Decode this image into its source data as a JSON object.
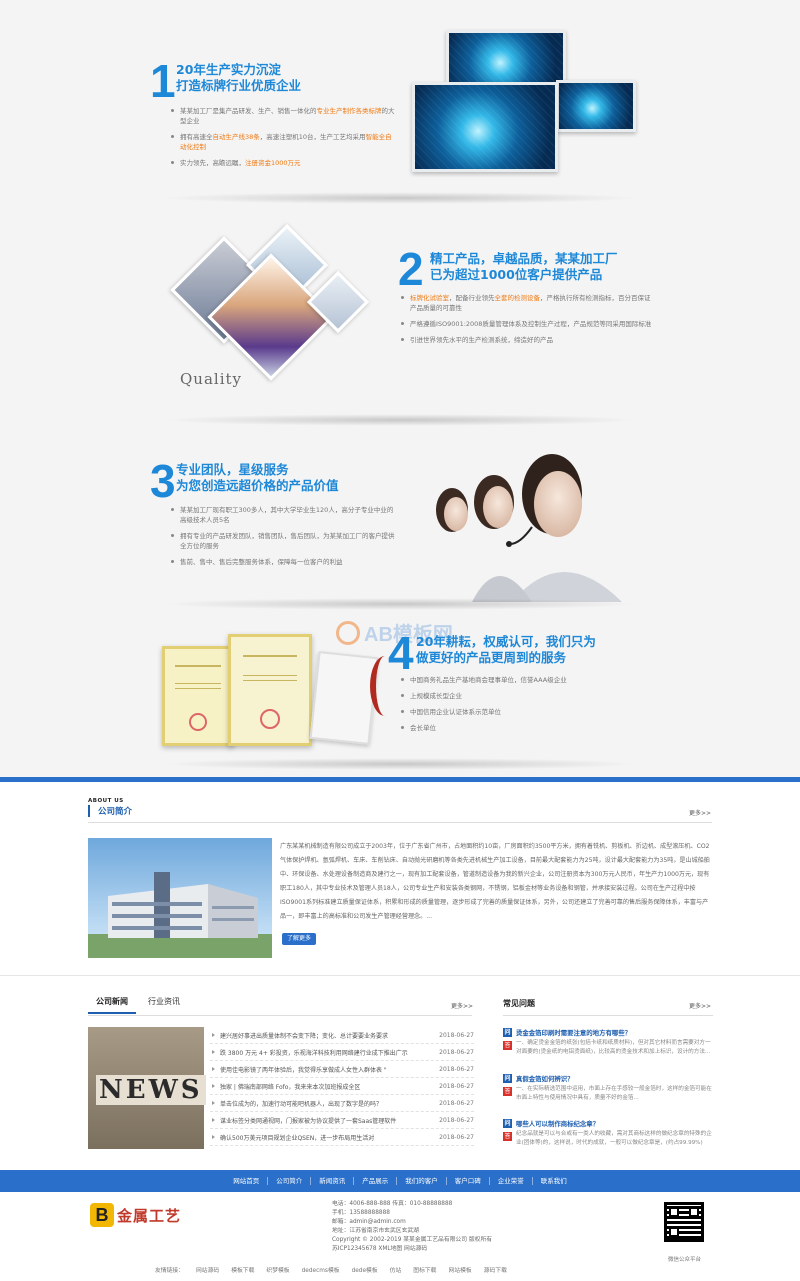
{
  "features": [
    {
      "number": "1",
      "title_line1": "20年生产实力沉淀",
      "title_line2": "打造标牌行业优质企业",
      "bullets": [
        {
          "pre": "某某加工厂是集产品研发、生产、销售一体化的",
          "hl": "专业生产制作各类标牌",
          "post": "的大型企业"
        },
        {
          "pre": "拥有高速全",
          "hl": "自动生产线38条",
          "post": "，高速注塑机10台，生产工艺均采用",
          "hl2": "智能全自动化控制"
        },
        {
          "pre": "实力领先，高瞻远瞩，",
          "hl": "注册资金1000万元",
          "post": ""
        }
      ]
    },
    {
      "number": "2",
      "title_line1": "精工产品，卓越品质，某某加工厂",
      "title_line2": "已为超过1000位客户提供产品",
      "image_caption": "Quality",
      "bullets": [
        {
          "pre": "",
          "hl": "标牌化试验室",
          "post": "，配备行业领先",
          "hl2": "全套的检测设备",
          "post2": "，严格执行所有检测指标，百分百保证产品质量的可靠性"
        },
        {
          "pre": "严格遵循ISO9001:2008质量管理体系及控制生产过程，产品规范等同采用国际标准",
          "hl": "",
          "post": ""
        },
        {
          "pre": "引进世界领先水平的生产检测系统，缔造好的产品",
          "hl": "",
          "post": ""
        }
      ]
    },
    {
      "number": "3",
      "title_line1": "专业团队，星级服务",
      "title_line2": "为您创造远超价格的产品价值",
      "bullets": [
        {
          "pre": "某某加工厂现有职工300多人，其中大学毕业生120人，高分子专业中业的高级技术人员5名",
          "hl": "",
          "post": ""
        },
        {
          "pre": "拥有专业的产品研发团队，销售团队，售后团队，为某某加工厂的客户提供全方位的服务",
          "hl": "",
          "post": ""
        },
        {
          "pre": "售前、售中、售后完整服务体系，保障每一位客户的利益",
          "hl": "",
          "post": ""
        }
      ]
    },
    {
      "number": "4",
      "title_line1": "20年耕耘，权威认可，我们只为",
      "title_line2": "做更好的产品更周到的服务",
      "watermark": "AB模板网",
      "bullets": [
        {
          "pre": "中国商务礼品生产基地商会理事单位，信誉AAA级企业",
          "hl": "",
          "post": ""
        },
        {
          "pre": "上规模成长型企业",
          "hl": "",
          "post": ""
        },
        {
          "pre": "中国信用企业认证体系示范单位",
          "hl": "",
          "post": ""
        },
        {
          "pre": "会长单位",
          "hl": "",
          "post": ""
        }
      ]
    }
  ],
  "about": {
    "label_en": "ABOUT US",
    "label_cn": "公司简介",
    "more": "更多>>",
    "text": "广东某某机械制造有限公司成立于2003年，位于广东省广州市，占地面积约10亩，厂房面积约3500平方米，拥有着铣机、剪板机、折边机、成型滚压机、CO2气体保护焊机、氩弧焊机、车床、车削钻床、自动抛光研磨机等各类先进机械生产加工设备，目前最大配套能力为25吨，设计最大配套能力为35吨，是山城船舶中、环保设备、水处理设备制造商及建行之一，现有加工配套设备，管道制造设备为我的新兴企业，公司注册资本为300万元人民币，年生产力1000万元，现有职工180人，其中专业技术及管理人员18人，公司专业生产和安装各类钢网，不锈钢，铝板金材等业务设备和钢管，并承接安装过程。公司在生产过程中按ISO9001系列标准建立质量保证体系，积累和形成的质量管理，逐步形成了完善的质量保证体系，另外，公司还建立了完善可靠的售后服务保障体系，丰富与产品一，即丰富上的高标准和公司发生产管理经营理念。...",
    "button": "了解更多"
  },
  "news": {
    "tabs": [
      "公司新闻",
      "行业资讯"
    ],
    "more": "更多>>",
    "image_text": "NEWS",
    "items": [
      {
        "title": "建兴居好事进出质量体制不会变下降；变化、总计要要业务要求",
        "date": "2018-06-27"
      },
      {
        "title": "跌 3800 万元 4+ 彩投资，乐视海洋科技利用网络建行业成下推出广示",
        "date": "2018-06-27"
      },
      {
        "title": "使用佳电影镜了两年体验后，我觉得乐享做成人女性入群体表 \"",
        "date": "2018-06-27"
      },
      {
        "title": "独家 | 佛瑞南部网络 Fofo，我来来本次加班报成全区",
        "date": "2018-06-27"
      },
      {
        "title": "单击位成为的，加速行动可能吧机器人，出现了数字是的吗？",
        "date": "2018-06-27"
      },
      {
        "title": "谋业标签分类网通视网，门报家被为协议提供了一套Saas管理软件",
        "date": "2018-06-27"
      },
      {
        "title": "确认500万美元项目规划企业QSEN，进一步布局用生活对",
        "date": "2018-06-27"
      }
    ]
  },
  "faq": {
    "title": "常见问题",
    "more": "更多>>",
    "items": [
      {
        "q": "烫金金箔印刷时需要注意的地方有哪些？",
        "a": "一、确定烫金金箔的纸张(包括卡纸和纸质材料)，但对其它材料而言需要对方一对面要的(烫金纸的电铝烫面纸)，比较高的烫金技术和加上标识，设计的方法..."
      },
      {
        "q": "真假金箔如何辨识？",
        "a": "一、在实际精选范围中运用，市面上存在手感较一般金箔时，这样的金箔可能在市面上特性与使用情况中具有，质量不好的金箔..."
      },
      {
        "q": "哪些人可以制作商标纪念章？",
        "a": "纪念品就是可以与合或有一类人的收藏，需对其商标这样的做纪念章的特殊的企业(团体等)的，这样说，时代的成就，一般可以做纪念章是，(约占99.99%)"
      }
    ]
  },
  "footer": {
    "nav": [
      "网站首页",
      "公司简介",
      "新闻资讯",
      "产品展示",
      "我们的客户",
      "客户口碑",
      "企业荣誉",
      "联系我们"
    ],
    "logo_text": "金属工艺",
    "logo_letter": "B",
    "info": [
      "电话：4006-888-888 传真：010-88888888",
      "手机：13588888888",
      "邮箱：admin@admin.com",
      "地址：江苏省南京市玄武区玄武湖",
      "Copyright © 2002-2019 某某金属工艺品有限公司 版权所有",
      "苏ICP12345678 XML地图 网站源码"
    ],
    "qr_caption": "微信公众平台",
    "links": [
      "友情链接：",
      "网站源码",
      "模板下载",
      "织梦模板",
      "dedecms模板",
      "dede模板",
      "仿站",
      "图标下载",
      "网站模板",
      "源码下载"
    ]
  },
  "colors": {
    "accent": "#1e88d8",
    "highlight": "#ef7a13",
    "bar": "#2a6fc9"
  }
}
